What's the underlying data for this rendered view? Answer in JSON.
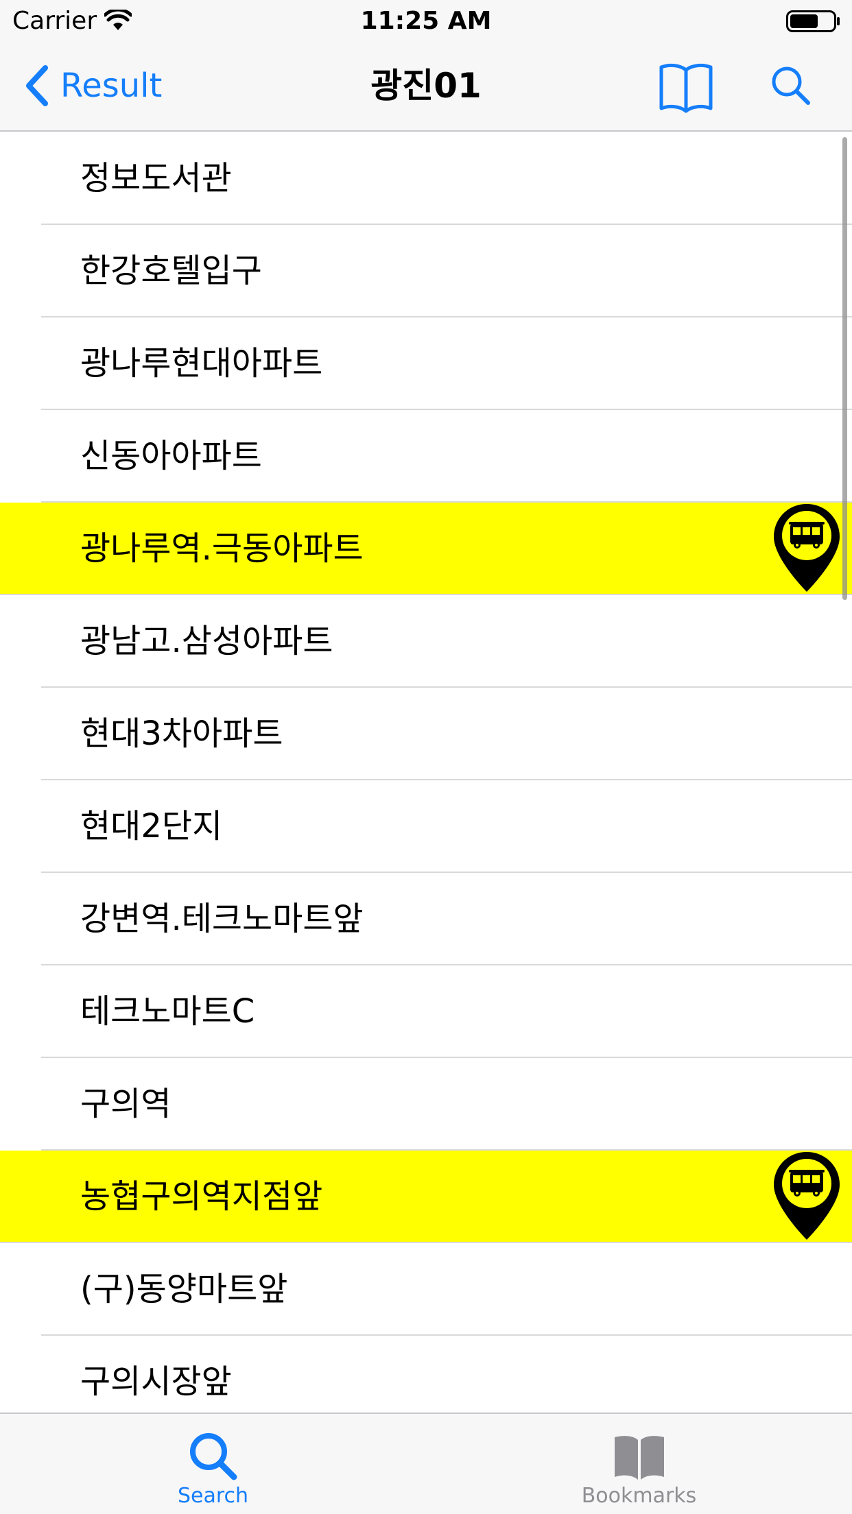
{
  "status": {
    "carrier": "Carrier",
    "time": "11:25 AM",
    "battery_level": 0.65
  },
  "nav": {
    "back_label": "Result",
    "title": "광진01",
    "book_icon": "book-icon",
    "search_icon": "search-icon"
  },
  "stops": [
    {
      "name": "정보도서관",
      "highlight": false
    },
    {
      "name": "한강호텔입구",
      "highlight": false
    },
    {
      "name": "광나루현대아파트",
      "highlight": false
    },
    {
      "name": "신동아아파트",
      "highlight": false
    },
    {
      "name": "광나루역.극동아파트",
      "highlight": true
    },
    {
      "name": "광남고.삼성아파트",
      "highlight": false
    },
    {
      "name": "현대3차아파트",
      "highlight": false
    },
    {
      "name": "현대2단지",
      "highlight": false
    },
    {
      "name": "강변역.테크노마트앞",
      "highlight": false
    },
    {
      "name": "테크노마트C",
      "highlight": false
    },
    {
      "name": "구의역",
      "highlight": false
    },
    {
      "name": "농협구의역지점앞",
      "highlight": true
    },
    {
      "name": "(구)동양마트앞",
      "highlight": false
    },
    {
      "name": "구의시장앞",
      "highlight": false
    }
  ],
  "tabs": {
    "search_label": "Search",
    "bookmarks_label": "Bookmarks"
  },
  "colors": {
    "accent": "#157efb",
    "highlight": "#ffff00",
    "inactive": "#8e8e93"
  }
}
